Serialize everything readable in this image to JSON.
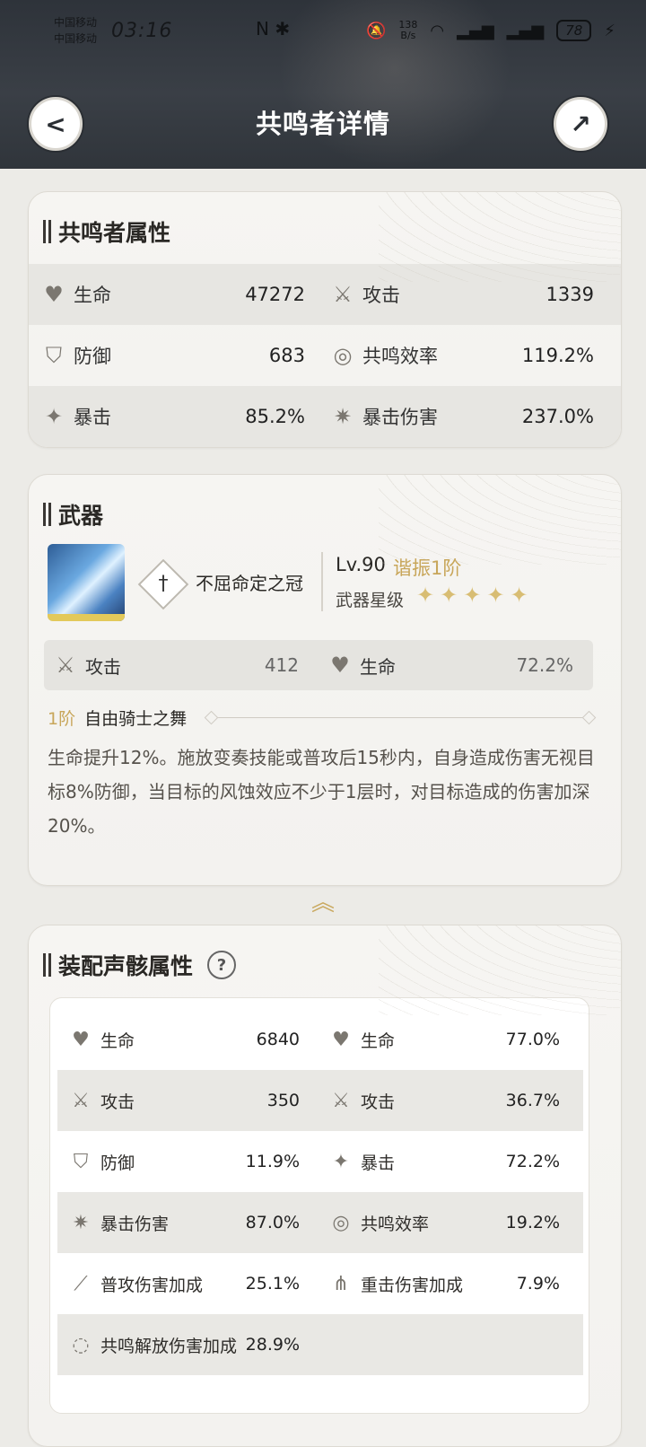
{
  "status_bar": {
    "carrier1": "中国移动",
    "carrier2": "中国移动",
    "time": "03:16",
    "icons_left": "N ✱",
    "speed_value": "138",
    "speed_unit": "B/s",
    "battery": "78"
  },
  "header": {
    "title": "共鸣者详情",
    "back_icon": "back-arrow-icon",
    "share_icon": "share-arrow-icon"
  },
  "attributes": {
    "title": "共鸣者属性",
    "rows": [
      {
        "l_label": "生命",
        "l_value": "47272",
        "r_label": "攻击",
        "r_value": "1339"
      },
      {
        "l_label": "防御",
        "l_value": "683",
        "r_label": "共鸣效率",
        "r_value": "119.2%"
      },
      {
        "l_label": "暴击",
        "l_value": "85.2%",
        "r_label": "暴击伤害",
        "r_value": "237.0%"
      }
    ]
  },
  "weapon": {
    "title": "武器",
    "name": "不屈命定之冠",
    "level": "Lv.90",
    "refine": "谐振1阶",
    "star_label": "武器星级",
    "stars": "✦✦✦✦✦",
    "stat_l_label": "攻击",
    "stat_l_value": "412",
    "stat_r_label": "生命",
    "stat_r_value": "72.2%",
    "passive_rank": "1阶",
    "passive_name": "自由骑士之舞",
    "passive_desc": "生命提升12%。施放变奏技能或普攻后15秒内，自身造成伤害无视目标8%防御，当目标的风蚀效应不少于1层时，对目标造成的伤害加深20%。"
  },
  "echo": {
    "title": "装配声骸属性",
    "help": "?",
    "rows": [
      {
        "l_label": "生命",
        "l_value": "6840",
        "r_label": "生命",
        "r_value": "77.0%"
      },
      {
        "l_label": "攻击",
        "l_value": "350",
        "r_label": "攻击",
        "r_value": "36.7%"
      },
      {
        "l_label": "防御",
        "l_value": "11.9%",
        "r_label": "暴击",
        "r_value": "72.2%"
      },
      {
        "l_label": "暴击伤害",
        "l_value": "87.0%",
        "r_label": "共鸣效率",
        "r_value": "19.2%"
      },
      {
        "l_label": "普攻伤害加成",
        "l_value": "25.1%",
        "r_label": "重击伤害加成",
        "r_value": "7.9%"
      },
      {
        "l_label": "共鸣解放伤害加成",
        "l_value": "28.9%",
        "r_label": "",
        "r_value": ""
      }
    ]
  }
}
